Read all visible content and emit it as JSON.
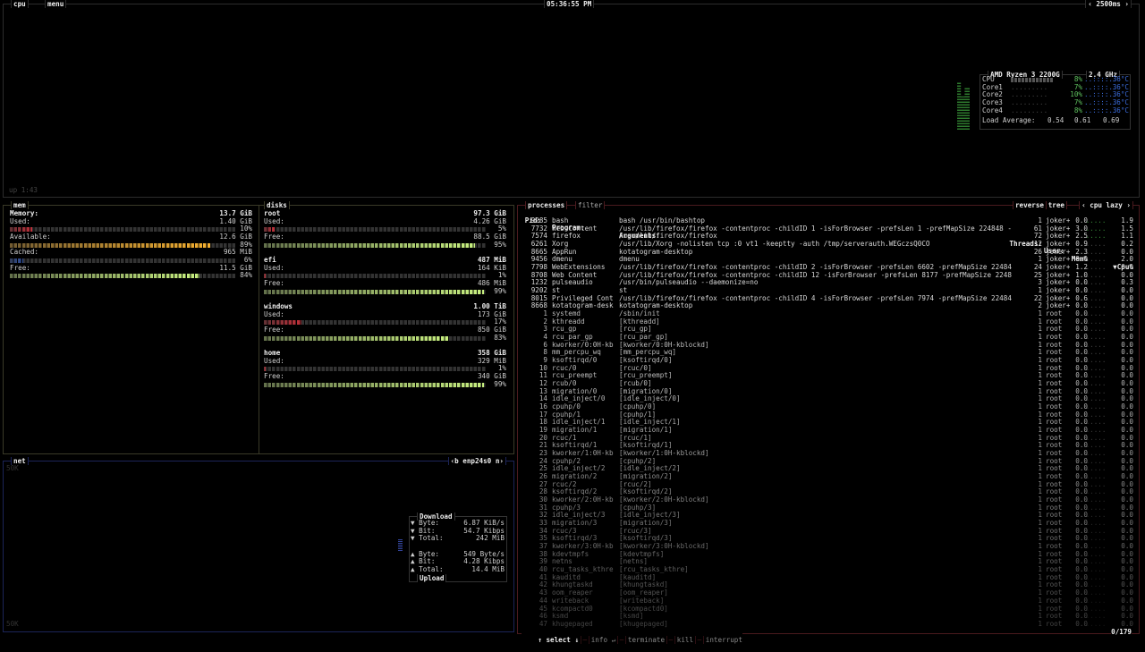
{
  "header": {
    "tab_cpu": "cpu",
    "tab_menu": "menu",
    "clock": "05:36:55 PM",
    "interval": "2500ms",
    "uptime": "up 1:43"
  },
  "cpu": {
    "model": "AMD Ryzen 3 2200G",
    "freq": "2.4 GHz",
    "rows": [
      {
        "label": "CPU",
        "pct": "8%",
        "temp": "36°C",
        "value": 8
      },
      {
        "label": "Core1",
        "pct": "7%",
        "temp": "36°C",
        "value": 7
      },
      {
        "label": "Core2",
        "pct": "10%",
        "temp": "36°C",
        "value": 10
      },
      {
        "label": "Core3",
        "pct": "7%",
        "temp": "36°C",
        "value": 7
      },
      {
        "label": "Core4",
        "pct": "8%",
        "temp": "36°C",
        "value": 8
      }
    ],
    "load_label": "Load Average:",
    "load": [
      "0.54",
      "0.61",
      "0.69"
    ]
  },
  "mem": {
    "title": "mem",
    "total_label": "Memory:",
    "total": "13.7 GiB",
    "items": [
      {
        "label": "Used:",
        "value": "1.40 GiB",
        "pct": "10%",
        "percent": 10,
        "color": "#c0303a"
      },
      {
        "label": "Available:",
        "value": "12.6 GiB",
        "pct": "89%",
        "percent": 89,
        "color": "#f5b030"
      },
      {
        "label": "Cached:",
        "value": "965 MiB",
        "pct": "6%",
        "percent": 6,
        "color": "#3050a0"
      },
      {
        "label": "Free:",
        "value": "11.5 GiB",
        "pct": "84%",
        "percent": 84,
        "color": "#c8f080"
      }
    ]
  },
  "disks": {
    "title": "disks",
    "items": [
      {
        "name": "root",
        "total": "97.3 GiB",
        "used": "4.26 GiB",
        "used_pct": "5%",
        "used_percent": 5,
        "free": "88.5 GiB",
        "free_pct": "95%",
        "free_percent": 95
      },
      {
        "name": "efi",
        "total": "487 MiB",
        "used": "164 KiB",
        "used_pct": "1%",
        "used_percent": 1,
        "free": "486 MiB",
        "free_pct": "99%",
        "free_percent": 99
      },
      {
        "name": "windows",
        "total": "1.00 TiB",
        "used": "173 GiB",
        "used_pct": "17%",
        "used_percent": 17,
        "free": "850 GiB",
        "free_pct": "83%",
        "free_percent": 83
      },
      {
        "name": "home",
        "total": "358 GiB",
        "used": "329 MiB",
        "used_pct": "1%",
        "used_percent": 1,
        "free": "340 GiB",
        "free_pct": "99%",
        "free_percent": 99
      }
    ],
    "used_label": "Used:",
    "free_label": "Free:"
  },
  "net": {
    "title": "net",
    "iface": "enp24s0",
    "prev_key": "‹b",
    "next_key": "n›",
    "scale_top": "50K",
    "scale_bottom": "50K",
    "download_label": "Download",
    "upload_label": "Upload",
    "download": [
      {
        "label": "▼ Byte:",
        "value": "6.87 KiB/s"
      },
      {
        "label": "▼ Bit:",
        "value": "54.7 Kibps"
      },
      {
        "label": "▼ Total:",
        "value": "242 MiB"
      }
    ],
    "upload": [
      {
        "label": "▲ Byte:",
        "value": "549 Byte/s"
      },
      {
        "label": "▲ Bit:",
        "value": "4.28 Kibps"
      },
      {
        "label": "▲ Total:",
        "value": "14.4 MiB"
      }
    ]
  },
  "proc": {
    "title": "processes",
    "filter": "filter",
    "reverse": "reverse",
    "tree": "tree",
    "sort": "‹ cpu lazy ›",
    "headers": {
      "pid": "Pid:",
      "program": "Program:",
      "args": "Arguments:",
      "threads": "Threads:",
      "user": "User:",
      "mem": "Mem%",
      "cpu": "▼Cpu%"
    },
    "rows": [
      [
        "9285",
        "bash",
        "bash /usr/bin/bashtop",
        "1",
        "joker+",
        "0.0",
        "1.9"
      ],
      [
        "7732",
        "Web Content",
        "/usr/lib/firefox/firefox -contentproc -childID 1 -isForBrowser -prefsLen 1 -prefMapSize 224848 -",
        "61",
        "joker+",
        "3.0",
        "1.5"
      ],
      [
        "7574",
        "firefox",
        "/usr/lib/firefox/firefox",
        "72",
        "joker+",
        "2.5",
        "1.1"
      ],
      [
        "6261",
        "Xorg",
        "/usr/lib/Xorg -nolisten tcp :0 vt1 -keeptty -auth /tmp/serverauth.WEGczsQ0CO",
        "12",
        "joker+",
        "0.9",
        "0.2"
      ],
      [
        "8665",
        "AppRun",
        "kotatogram-desktop",
        "26",
        "joker+",
        "2.3",
        "0.0"
      ],
      [
        "9456",
        "dmenu",
        "dmenu",
        "1",
        "joker+",
        "0.0",
        "2.0"
      ],
      [
        "7798",
        "WebExtensions",
        "/usr/lib/firefox/firefox -contentproc -childID 2 -isForBrowser -prefsLen 6602 -prefMapSize 22484",
        "24",
        "joker+",
        "1.2",
        "0.0"
      ],
      [
        "8708",
        "Web Content",
        "/usr/lib/firefox/firefox -contentproc -childID 12 -isForBrowser -prefsLen 8177 -prefMapSize 2248",
        "25",
        "joker+",
        "1.0",
        "0.0"
      ],
      [
        "1232",
        "pulseaudio",
        "/usr/bin/pulseaudio --daemonize=no",
        "3",
        "joker+",
        "0.0",
        "0.3"
      ],
      [
        "9202",
        "st",
        "st",
        "1",
        "joker+",
        "0.0",
        "0.0"
      ],
      [
        "8015",
        "Privileged Cont",
        "/usr/lib/firefox/firefox -contentproc -childID 4 -isForBrowser -prefsLen 7974 -prefMapSize 22484",
        "22",
        "joker+",
        "0.6",
        "0.0"
      ],
      [
        "8668",
        "kotatogram-desk",
        "kotatogram-desktop",
        "2",
        "joker+",
        "0.0",
        "0.0"
      ],
      [
        "1",
        "systemd",
        "/sbin/init",
        "1",
        "root",
        "0.0",
        "0.0"
      ],
      [
        "2",
        "kthreadd",
        "[kthreadd]",
        "1",
        "root",
        "0.0",
        "0.0"
      ],
      [
        "3",
        "rcu_gp",
        "[rcu_gp]",
        "1",
        "root",
        "0.0",
        "0.0"
      ],
      [
        "4",
        "rcu_par_gp",
        "[rcu_par_gp]",
        "1",
        "root",
        "0.0",
        "0.0"
      ],
      [
        "6",
        "kworker/0:0H-kb",
        "[kworker/0:0H-kblockd]",
        "1",
        "root",
        "0.0",
        "0.0"
      ],
      [
        "8",
        "mm_percpu_wq",
        "[mm_percpu_wq]",
        "1",
        "root",
        "0.0",
        "0.0"
      ],
      [
        "9",
        "ksoftirqd/0",
        "[ksoftirqd/0]",
        "1",
        "root",
        "0.0",
        "0.0"
      ],
      [
        "10",
        "rcuc/0",
        "[rcuc/0]",
        "1",
        "root",
        "0.0",
        "0.0"
      ],
      [
        "11",
        "rcu_preempt",
        "[rcu_preempt]",
        "1",
        "root",
        "0.0",
        "0.0"
      ],
      [
        "12",
        "rcub/0",
        "[rcub/0]",
        "1",
        "root",
        "0.0",
        "0.0"
      ],
      [
        "13",
        "migration/0",
        "[migration/0]",
        "1",
        "root",
        "0.0",
        "0.0"
      ],
      [
        "14",
        "idle_inject/0",
        "[idle_inject/0]",
        "1",
        "root",
        "0.0",
        "0.0"
      ],
      [
        "16",
        "cpuhp/0",
        "[cpuhp/0]",
        "1",
        "root",
        "0.0",
        "0.0"
      ],
      [
        "17",
        "cpuhp/1",
        "[cpuhp/1]",
        "1",
        "root",
        "0.0",
        "0.0"
      ],
      [
        "18",
        "idle_inject/1",
        "[idle_inject/1]",
        "1",
        "root",
        "0.0",
        "0.0"
      ],
      [
        "19",
        "migration/1",
        "[migration/1]",
        "1",
        "root",
        "0.0",
        "0.0"
      ],
      [
        "20",
        "rcuc/1",
        "[rcuc/1]",
        "1",
        "root",
        "0.0",
        "0.0"
      ],
      [
        "21",
        "ksoftirqd/1",
        "[ksoftirqd/1]",
        "1",
        "root",
        "0.0",
        "0.0"
      ],
      [
        "23",
        "kworker/1:0H-kb",
        "[kworker/1:0H-kblockd]",
        "1",
        "root",
        "0.0",
        "0.0"
      ],
      [
        "24",
        "cpuhp/2",
        "[cpuhp/2]",
        "1",
        "root",
        "0.0",
        "0.0"
      ],
      [
        "25",
        "idle_inject/2",
        "[idle_inject/2]",
        "1",
        "root",
        "0.0",
        "0.0"
      ],
      [
        "26",
        "migration/2",
        "[migration/2]",
        "1",
        "root",
        "0.0",
        "0.0"
      ],
      [
        "27",
        "rcuc/2",
        "[rcuc/2]",
        "1",
        "root",
        "0.0",
        "0.0"
      ],
      [
        "28",
        "ksoftirqd/2",
        "[ksoftirqd/2]",
        "1",
        "root",
        "0.0",
        "0.0"
      ],
      [
        "30",
        "kworker/2:0H-kb",
        "[kworker/2:0H-kblockd]",
        "1",
        "root",
        "0.0",
        "0.0"
      ],
      [
        "31",
        "cpuhp/3",
        "[cpuhp/3]",
        "1",
        "root",
        "0.0",
        "0.0"
      ],
      [
        "32",
        "idle_inject/3",
        "[idle_inject/3]",
        "1",
        "root",
        "0.0",
        "0.0"
      ],
      [
        "33",
        "migration/3",
        "[migration/3]",
        "1",
        "root",
        "0.0",
        "0.0"
      ],
      [
        "34",
        "rcuc/3",
        "[rcuc/3]",
        "1",
        "root",
        "0.0",
        "0.0"
      ],
      [
        "35",
        "ksoftirqd/3",
        "[ksoftirqd/3]",
        "1",
        "root",
        "0.0",
        "0.0"
      ],
      [
        "37",
        "kworker/3:0H-kb",
        "[kworker/3:0H-kblockd]",
        "1",
        "root",
        "0.0",
        "0.0"
      ],
      [
        "38",
        "kdevtmpfs",
        "[kdevtmpfs]",
        "1",
        "root",
        "0.0",
        "0.0"
      ],
      [
        "39",
        "netns",
        "[netns]",
        "1",
        "root",
        "0.0",
        "0.0"
      ],
      [
        "40",
        "rcu_tasks_kthre",
        "[rcu_tasks_kthre]",
        "1",
        "root",
        "0.0",
        "0.0"
      ],
      [
        "41",
        "kauditd",
        "[kauditd]",
        "1",
        "root",
        "0.0",
        "0.0"
      ],
      [
        "42",
        "khungtaskd",
        "[khungtaskd]",
        "1",
        "root",
        "0.0",
        "0.0"
      ],
      [
        "43",
        "oom_reaper",
        "[oom_reaper]",
        "1",
        "root",
        "0.0",
        "0.0"
      ],
      [
        "44",
        "writeback",
        "[writeback]",
        "1",
        "root",
        "0.0",
        "0.0"
      ],
      [
        "45",
        "kcompactd0",
        "[kcompactd0]",
        "1",
        "root",
        "0.0",
        "0.0"
      ],
      [
        "46",
        "ksmd",
        "[ksmd]",
        "1",
        "root",
        "0.0",
        "0.0"
      ],
      [
        "47",
        "khugepaged",
        "[khugepaged]",
        "1",
        "root",
        "0.0",
        "0.0"
      ]
    ],
    "footer": {
      "select": "↑ select ↓",
      "info": "info ↵",
      "terminate": "terminate",
      "kill": "kill",
      "interrupt": "interrupt",
      "count": "0/179"
    }
  },
  "colors": {
    "cpu_border": "#2c2c2c",
    "mem_border": "#3a3a28",
    "net_border": "#1c2458",
    "proc_border": "#4a1a1e",
    "cpu_green": "#5fc35f",
    "temp_blue": "#3a6ad8"
  }
}
